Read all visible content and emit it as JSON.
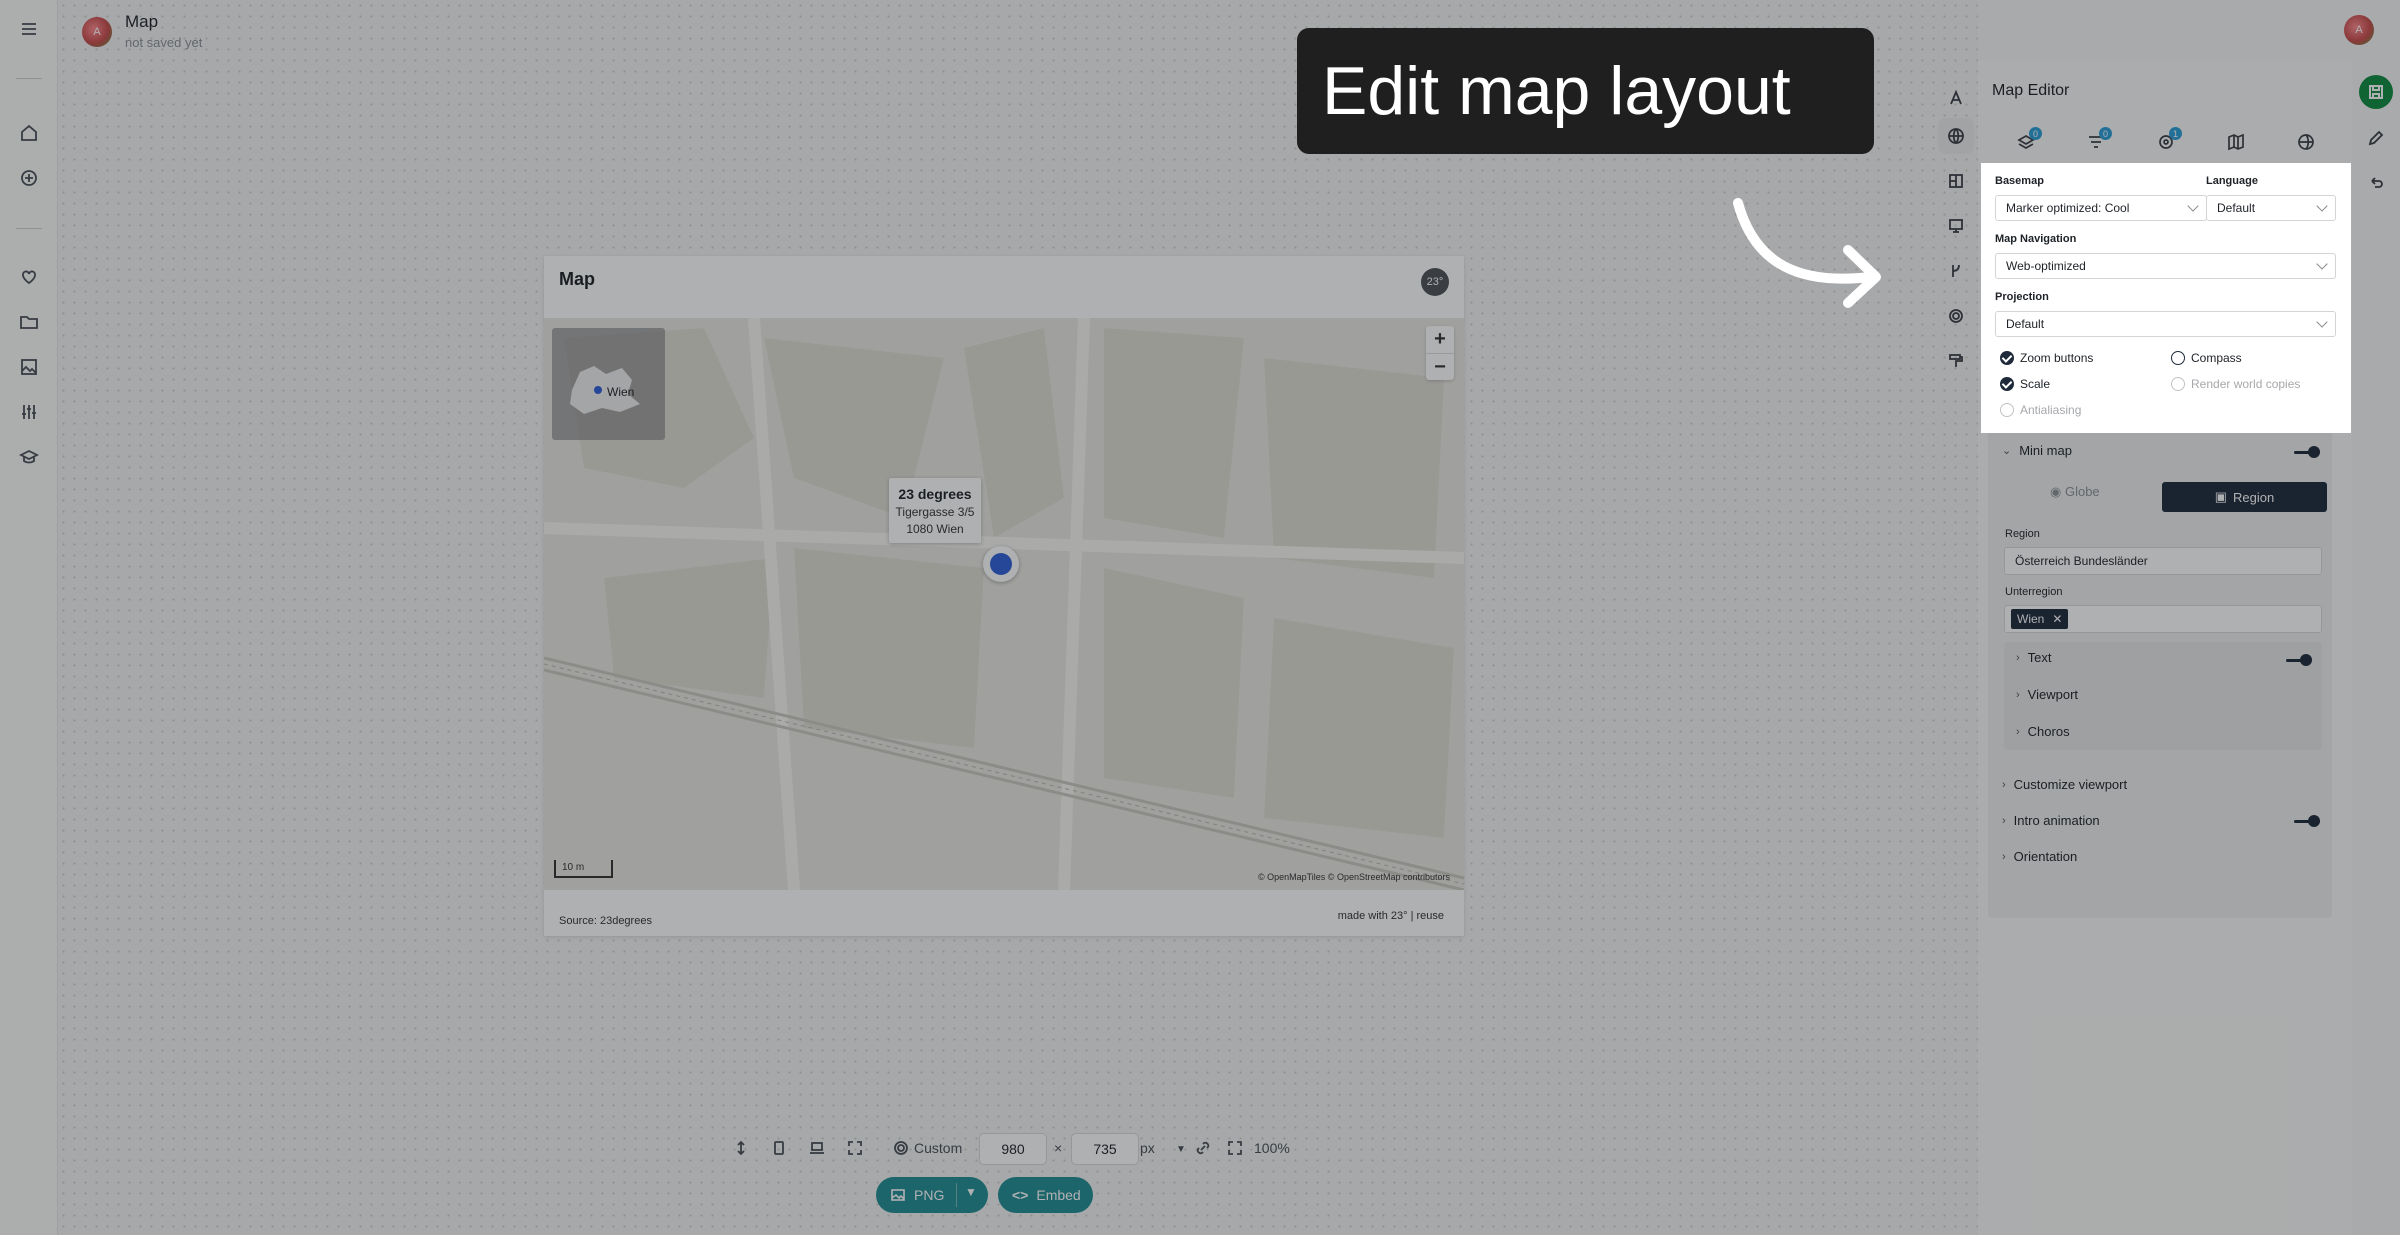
{
  "header": {
    "title": "Map",
    "subtitle": "not saved yet",
    "avatar_letter": "A"
  },
  "map_card": {
    "title": "Map",
    "logo_text": "23°",
    "minimap_label": "Wien",
    "zoom_in": "+",
    "zoom_out": "−",
    "tooltip": {
      "title": "23 degrees",
      "line1": "Tigergasse 3/5",
      "line2": "1080 Wien"
    },
    "scale_label": "10 m",
    "attribution": "© OpenMapTiles © OpenStreetMap contributors",
    "source": "Source: 23degrees",
    "made_with": "made with 23° | reuse"
  },
  "bottom_bar": {
    "preset": "Custom",
    "width": "980",
    "times": "×",
    "height": "735",
    "unit": "px",
    "zoom": "100%",
    "png_label": "PNG",
    "embed_label": "Embed"
  },
  "callout": {
    "text": "Edit map layout"
  },
  "editor": {
    "title": "Map Editor",
    "tab_badges": [
      "0",
      "0",
      "1"
    ],
    "basemap_label": "Basemap",
    "basemap_value": "Marker optimized: Cool",
    "language_label": "Language",
    "language_value": "Default",
    "navigation_label": "Map Navigation",
    "navigation_value": "Web-optimized",
    "projection_label": "Projection",
    "projection_value": "Default",
    "options": {
      "zoom_buttons": "Zoom buttons",
      "compass": "Compass",
      "scale": "Scale",
      "render_world_copies": "Render world copies",
      "antialiasing": "Antialiasing"
    },
    "mini_map": {
      "title": "Mini map",
      "globe": "Globe",
      "region": "Region",
      "region_label": "Region",
      "region_value": "Österreich Bundesländer",
      "subregion_label": "Unterregion",
      "subregion_chip": "Wien",
      "sub_sections": [
        "Text",
        "Viewport",
        "Choros"
      ]
    },
    "sections": [
      "Customize viewport",
      "Intro animation",
      "Orientation"
    ]
  },
  "colors": {
    "accent": "#1f8e93",
    "dark": "#1e2a3a",
    "save": "#0f8a3f"
  }
}
